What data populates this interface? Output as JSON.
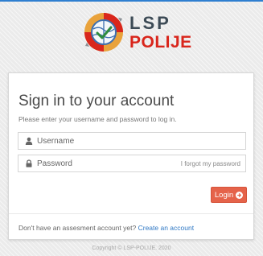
{
  "brand": {
    "line1": "LSP",
    "line2": "POLIJE",
    "logo_icon": "globe-logo-icon"
  },
  "login": {
    "title": "Sign in to your account",
    "subtitle": "Please enter your username and password to log in.",
    "username_placeholder": "Username",
    "username_value": "",
    "username_icon": "user-icon",
    "password_placeholder": "Password",
    "password_value": "",
    "password_icon": "lock-icon",
    "forgot_label": "I forgot my password",
    "login_label": "Login",
    "login_icon": "arrow-circle-right-icon",
    "login_color": "#e5634a"
  },
  "signup": {
    "prompt": "Don't have an assesment account yet?",
    "link_label": "Create an account"
  },
  "footer": {
    "copyright": "Copyright © LSP-POLIJE. 2020"
  },
  "colors": {
    "accent_blue": "#2f7fd0",
    "brand_red": "#d9261c",
    "brand_dark": "#3d4b56",
    "link": "#2f78c4"
  }
}
